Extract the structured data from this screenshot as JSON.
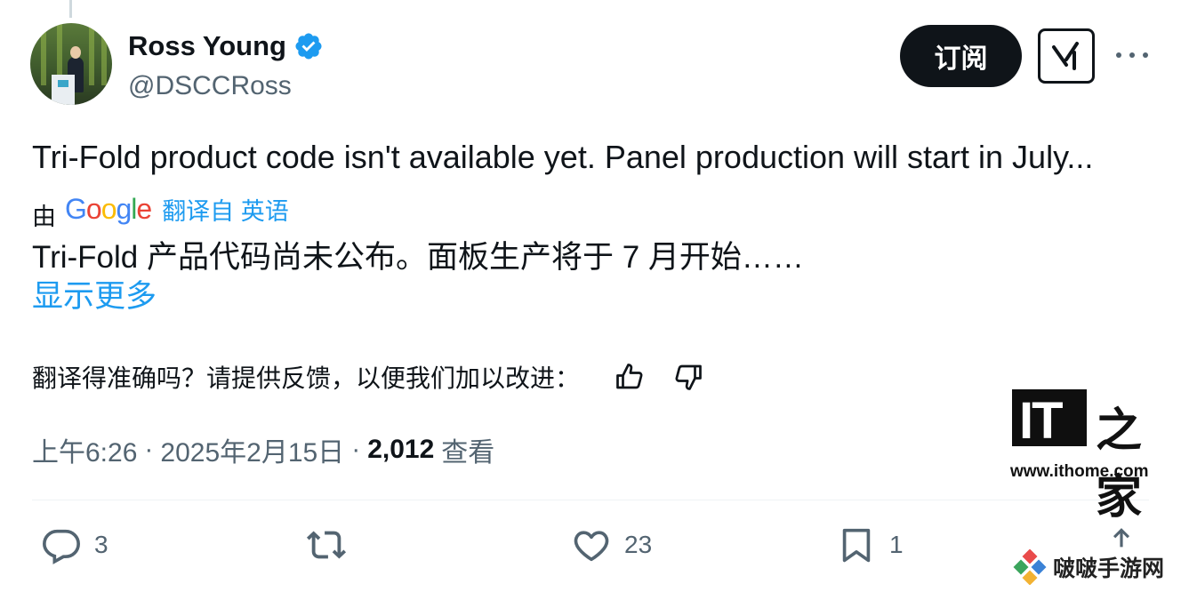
{
  "user": {
    "name": "Ross Young",
    "handle": "@DSCCRoss"
  },
  "header": {
    "subscribe_label": "订阅"
  },
  "tweet": {
    "text": "Tri-Fold product code isn't available yet. Panel production will start in July...",
    "translated_by_prefix": "由",
    "google_letters": [
      "G",
      "o",
      "o",
      "g",
      "l",
      "e"
    ],
    "translated_from_label": "翻译自 英语",
    "translated_text": "Tri-Fold 产品代码尚未公布。面板生产将于 7 月开始……",
    "show_more_label": "显示更多"
  },
  "feedback": {
    "prompt": "翻译得准确吗？请提供反馈，以便我们加以改进："
  },
  "meta": {
    "time": "上午6:26",
    "separator": "·",
    "date": "2025年2月15日",
    "views_count": "2,012",
    "views_label": "查看"
  },
  "actions": {
    "reply_count": "3",
    "like_count": "23",
    "bookmark_count": "1"
  },
  "watermarks": {
    "it_letters": "IT",
    "it_chinese": "之家",
    "ithome_url": "www.ithome.com",
    "bobo_text": "啵啵手游网"
  },
  "colors": {
    "primary_text": "#0f1419",
    "secondary_text": "#536471",
    "link_blue": "#1d9bf0",
    "verified_blue": "#1d9bf0",
    "google_blue": "#4285f4",
    "google_red": "#ea4335",
    "google_yellow": "#fbbc05",
    "google_green": "#34a853"
  },
  "icons": {
    "verified": "verified-badge-icon",
    "grok": "grok-icon",
    "more": "more-dots-icon",
    "thumbs_up": "thumbs-up-icon",
    "thumbs_down": "thumbs-down-icon",
    "reply": "reply-icon",
    "retweet": "retweet-icon",
    "like": "heart-icon",
    "bookmark": "bookmark-icon",
    "share": "share-icon"
  }
}
